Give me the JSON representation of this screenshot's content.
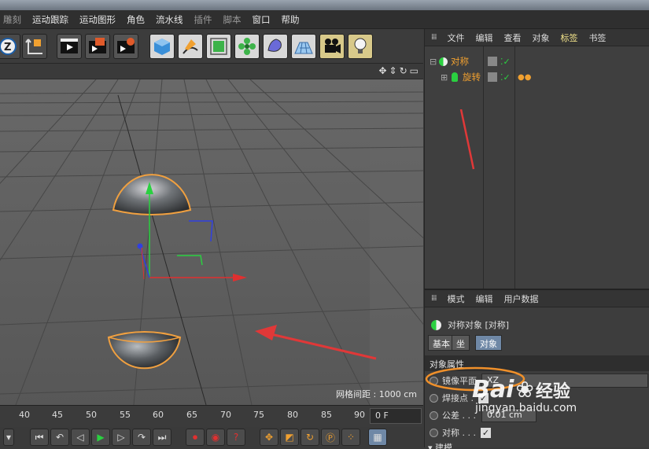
{
  "menubar": {
    "items": [
      "雕刻",
      "运动跟踪",
      "运动图形",
      "角色",
      "流水线",
      "插件",
      "脚本",
      "窗口",
      "帮助"
    ],
    "dim": [
      0,
      5,
      6
    ]
  },
  "toolbar": {
    "icons": [
      "undo-z-icon",
      "axis-icon",
      "render-view-icon",
      "render-region-icon",
      "render-settings-icon",
      "cube-icon",
      "pen-spline-icon",
      "subdivision-icon",
      "mograph-cloner-icon",
      "deformer-icon",
      "floor-grid-icon",
      "camera-icon",
      "light-icon"
    ]
  },
  "viewport": {
    "grid_label": "网格间距 : 1000 cm"
  },
  "timeline": {
    "ticks": [
      "40",
      "45",
      "50",
      "55",
      "60",
      "65",
      "70",
      "75",
      "80",
      "85",
      "90"
    ],
    "frame": "0 F"
  },
  "object_manager": {
    "menu": [
      "文件",
      "编辑",
      "查看",
      "对象",
      "标签",
      "书签"
    ],
    "highlight_index": 4,
    "objects": [
      {
        "name": "对称",
        "depth": 0
      },
      {
        "name": "旋转",
        "depth": 1
      }
    ]
  },
  "attributes": {
    "menu": [
      "模式",
      "编辑",
      "用户数据"
    ],
    "title": "对称对象 [对称]",
    "tabs": [
      "基本",
      "坐标",
      "对象"
    ],
    "active_tab": 2,
    "tab_labels_visible": [
      "基本",
      "坐",
      "对象"
    ],
    "section": "对象属性",
    "props": [
      {
        "label": "镜像平面",
        "value": "XZ"
      },
      {
        "label": "焊接点 .",
        "check": true
      },
      {
        "label": "公差 . . .",
        "value": "0.01 cm"
      },
      {
        "label": "对称 . . .",
        "check": true
      }
    ],
    "footer": "建模"
  },
  "watermark": {
    "brand": "Bai",
    "brand2": "经验",
    "url": "jingyan.baidu.com"
  }
}
